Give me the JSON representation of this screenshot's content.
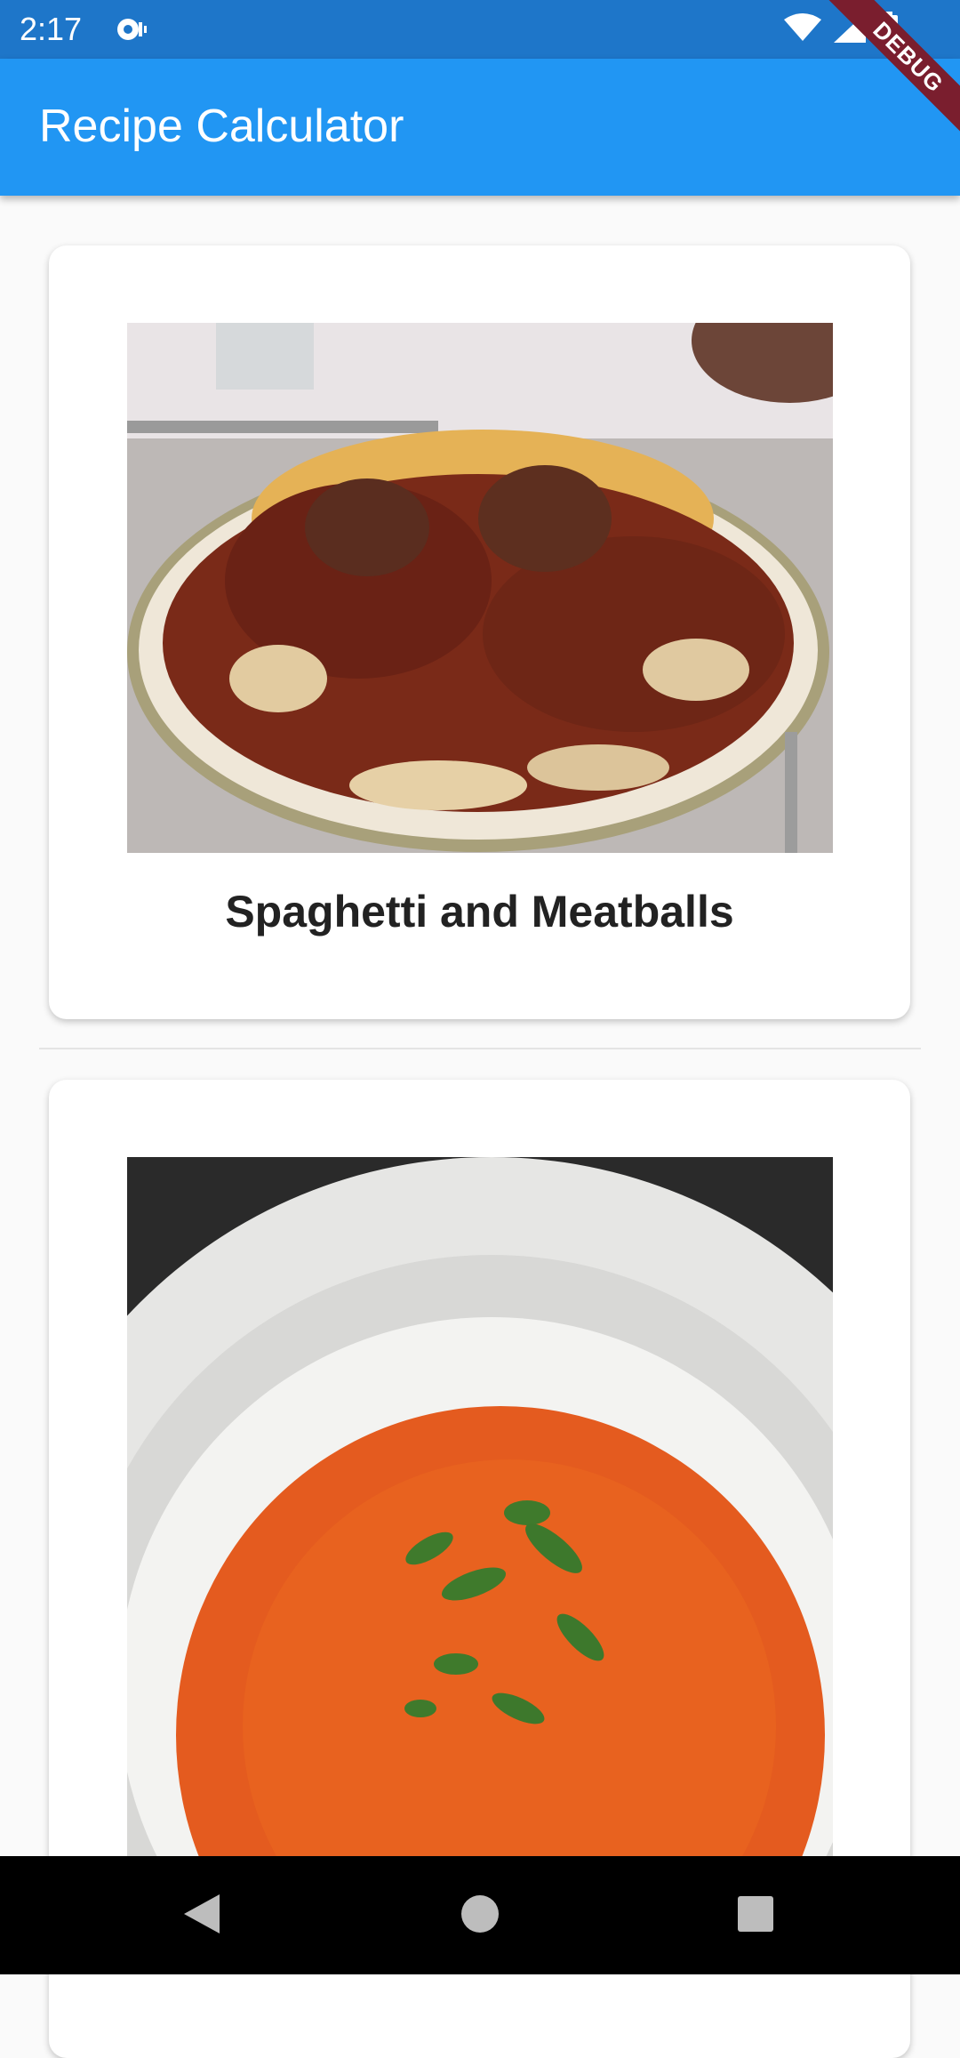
{
  "status_bar": {
    "time": "2:17",
    "icons": [
      "notification-icon",
      "wifi-icon",
      "signal-icon",
      "battery-icon"
    ]
  },
  "debug_banner": {
    "label": "DEBUG"
  },
  "app_bar": {
    "title": "Recipe Calculator"
  },
  "recipes": [
    {
      "name": "Spaghetti and Meatballs",
      "image": "spaghetti-meatballs-photo"
    },
    {
      "name": "",
      "image": "tomato-soup-photo"
    }
  ],
  "nav_bar": {
    "buttons": [
      "back-icon",
      "home-icon",
      "recents-icon"
    ]
  },
  "colors": {
    "status_bar": "#1e76c9",
    "app_bar": "#2196f3",
    "background": "#fafafa",
    "card": "#ffffff",
    "debug_banner": "#7a1e2e"
  }
}
